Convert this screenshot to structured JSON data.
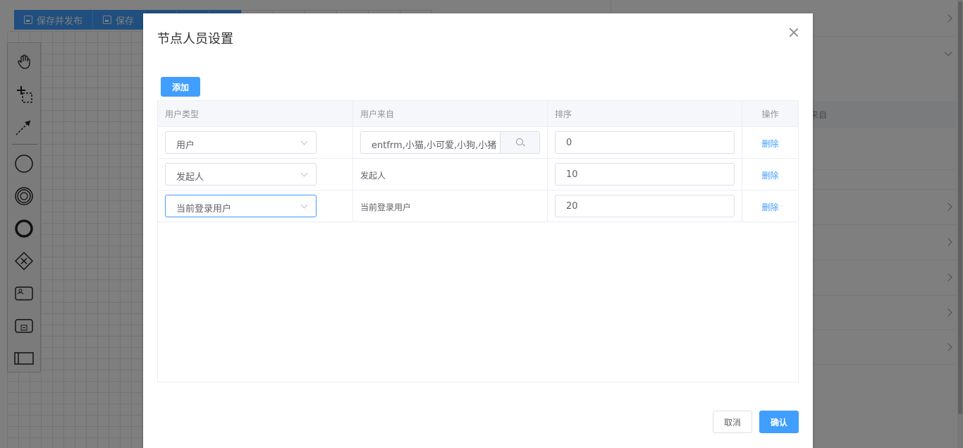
{
  "background": {
    "toolbar": {
      "save_publish_label": "保存并发布",
      "save_label": "保存"
    },
    "right_panel": {
      "column_label": "来自"
    },
    "palette_tools": [
      "hand-tool-icon",
      "lasso-tool-icon",
      "connect-tool-icon",
      "start-event-icon",
      "intermediate-event-icon",
      "end-event-icon",
      "gateway-icon",
      "user-task-icon",
      "subprocess-icon",
      "pool-icon"
    ]
  },
  "dialog": {
    "title": "节点人员设置",
    "add_label": "添加",
    "cancel_label": "取消",
    "confirm_label": "确认",
    "table": {
      "headers": {
        "user_type": "用户类型",
        "user_source": "用户来自",
        "order": "排序",
        "action": "操作"
      },
      "rows": [
        {
          "user_type": "用户",
          "user_source": "entfrm,小猫,小可爱,小狗,小猪",
          "order": "0",
          "action": "删除"
        },
        {
          "user_type": "发起人",
          "user_source": "发起人",
          "order": "10",
          "action": "删除"
        },
        {
          "user_type": "当前登录用户",
          "user_source": "当前登录用户",
          "order": "20",
          "action": "删除"
        }
      ]
    }
  },
  "colors": {
    "primary": "#409eff",
    "text": "#606266",
    "muted": "#909399",
    "border": "#dcdfe6",
    "header_bg": "#f5f7fa"
  }
}
